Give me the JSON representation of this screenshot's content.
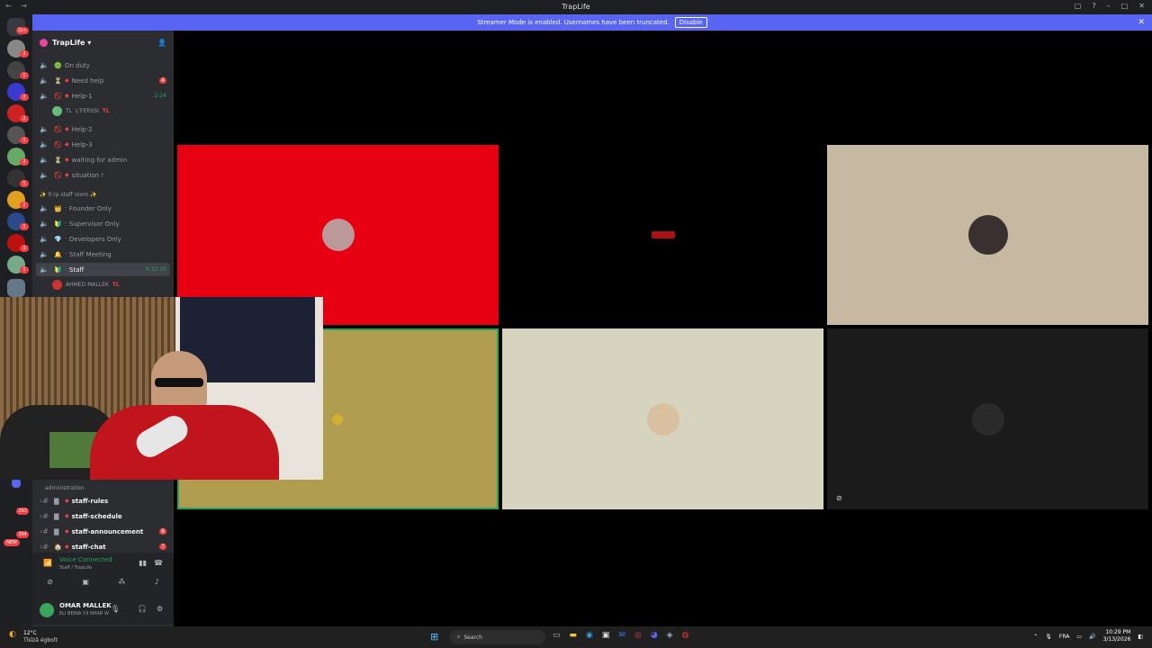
{
  "window": {
    "title": "TrapLife"
  },
  "banner": {
    "text": "Streamer Mode is enabled. Usernames have been truncated.",
    "button": "Disable"
  },
  "guild_badges": [
    "1k+",
    "2",
    "1",
    "2",
    "2",
    "1",
    "2",
    "1",
    "2",
    "1",
    "3",
    "1",
    "1",
    "2"
  ],
  "server": {
    "name": "TrapLife"
  },
  "channels": [
    {
      "emoji": "🟢",
      "name": "On duty",
      "right": ""
    },
    {
      "emoji": "⏳",
      "name": "Need help",
      "right": "4"
    },
    {
      "emoji": "🚫",
      "name": "Help-1",
      "right": "2:24"
    },
    {
      "emoji": "🚫",
      "name": "Help-2",
      "right": ""
    },
    {
      "emoji": "🚫",
      "name": "Help-3",
      "right": ""
    },
    {
      "emoji": "⏳",
      "name": "waiting for admin",
      "right": ""
    },
    {
      "emoji": "🚫",
      "name": "situation !",
      "right": ""
    }
  ],
  "help1_user": {
    "prefix": "TL",
    "name": "L'FERSSI",
    "tag": "TL"
  },
  "staff_category": "✨ tl.rp staff room ✨",
  "staff_channels": [
    {
      "emoji": "👑",
      "name": "Founder Only",
      "right": ""
    },
    {
      "emoji": "🔰",
      "name": "Supervisor Only",
      "right": ""
    },
    {
      "emoji": "💎",
      "name": "Developers Only",
      "right": ""
    },
    {
      "emoji": "🔔",
      "name": "Staff Meeting",
      "right": ""
    },
    {
      "emoji": "🔰",
      "name": "Staff",
      "right": "6:32:10"
    }
  ],
  "staff_user": {
    "name": "AHMED MALLEK",
    "tag": "TL"
  },
  "admin_category": "administration",
  "text_channels": [
    {
      "name": "staff-rules",
      "right": ""
    },
    {
      "name": "staff-schedule",
      "right": ""
    },
    {
      "name": "staff-announcement",
      "right": "6"
    },
    {
      "name": "staff-chat",
      "right": "7"
    }
  ],
  "guild_bottom_badges": [
    "293",
    "394",
    "NEW"
  ],
  "voice": {
    "status": "Voice Connected",
    "channel": "Staff / TrapLife"
  },
  "user_panel": {
    "name": "OMAR MALLEK",
    "status": "ELI BEINA Y.II NHAR W"
  },
  "taskbar": {
    "temperature": "12°C",
    "weather_text": "Tîsîzâ égboît",
    "search": "Search",
    "language": "FRA",
    "time": "10:29 PM",
    "date": "3/13/2026"
  },
  "tiles": [
    {
      "bg": "#e60012"
    },
    {
      "bg": "#000000"
    },
    {
      "bg": "#c6b8a1"
    },
    {
      "bg": "#b09d50"
    },
    {
      "bg": "#d6d4bf"
    },
    {
      "bg": "#1b1b1b"
    }
  ]
}
